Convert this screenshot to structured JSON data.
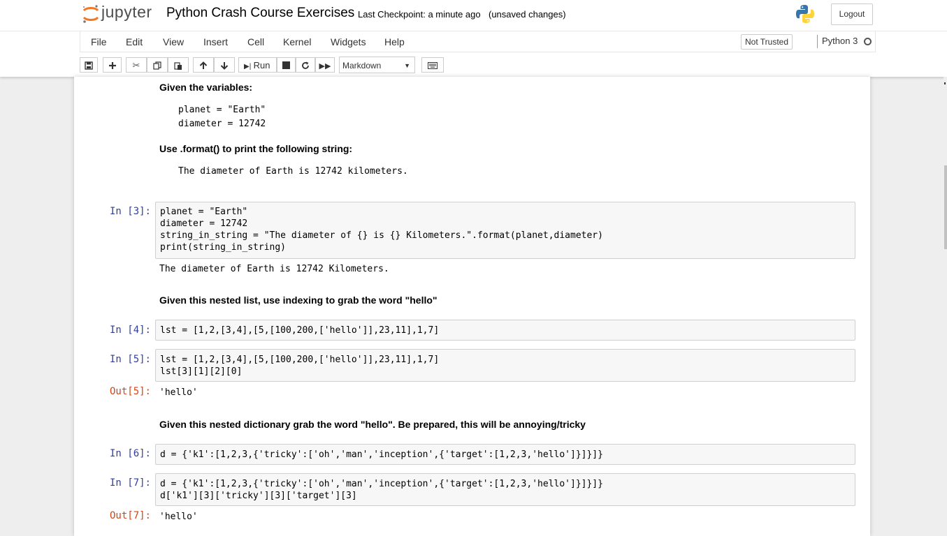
{
  "header": {
    "logo_text": "jupyter",
    "notebook_title": "Python Crash Course Exercises",
    "checkpoint": "Last Checkpoint: a minute ago",
    "save_status": "(unsaved changes)",
    "logout_label": "Logout"
  },
  "menu": {
    "items": [
      "File",
      "Edit",
      "View",
      "Insert",
      "Cell",
      "Kernel",
      "Widgets",
      "Help"
    ],
    "trust_label": "Not Trusted",
    "kernel_name": "Python 3"
  },
  "toolbar": {
    "run_label": "Run",
    "cell_type": "Markdown",
    "icons": [
      "save-icon",
      "plus-icon",
      "cut-icon",
      "copy-icon",
      "paste-icon",
      "arrow-up-icon",
      "arrow-down-icon",
      "run-icon",
      "stop-icon",
      "restart-icon",
      "fast-forward-icon",
      "keyboard-icon"
    ]
  },
  "cells": {
    "md1_heading": "Given the variables:",
    "md1_code_line1": "planet = \"Earth\"",
    "md1_code_line2": "diameter = 12742",
    "md2_heading": "Use .format() to print the following string:",
    "md2_code": "The diameter of Earth is 12742 kilometers.",
    "c3_prompt": "In [3]:",
    "c3_line1": "planet = \"Earth\"",
    "c3_line2": "diameter = 12742",
    "c3_line3": "string_in_string = \"The diameter of {} is {} Kilometers.\".format(planet,diameter)",
    "c3_line4": "print(string_in_string)",
    "c3_output": "The diameter of Earth is 12742 Kilometers.",
    "md3_heading": "Given this nested list, use indexing to grab the word \"hello\"",
    "c4_prompt": "In [4]:",
    "c4_line1": "lst = [1,2,[3,4],[5,[100,200,['hello']],23,11],1,7]",
    "c5_prompt": "In [5]:",
    "c5_line1": "lst = [1,2,[3,4],[5,[100,200,['hello']],23,11],1,7]",
    "c5_line2": "lst[3][1][2][0]",
    "c5_out_prompt": "Out[5]:",
    "c5_output": "'hello'",
    "md4_heading": "Given this nested dictionary grab the word \"hello\". Be prepared, this will be annoying/tricky",
    "c6_prompt": "In [6]:",
    "c6_line1": "d = {'k1':[1,2,3,{'tricky':['oh','man','inception',{'target':[1,2,3,'hello']}]}]}",
    "c7_prompt": "In [7]:",
    "c7_line1": "d = {'k1':[1,2,3,{'tricky':['oh','man','inception',{'target':[1,2,3,'hello']}]}]}",
    "c7_line2": "d['k1'][3]['tricky'][3]['target'][3]",
    "c7_out_prompt": "Out[7]:",
    "c7_output": "'hello'"
  }
}
